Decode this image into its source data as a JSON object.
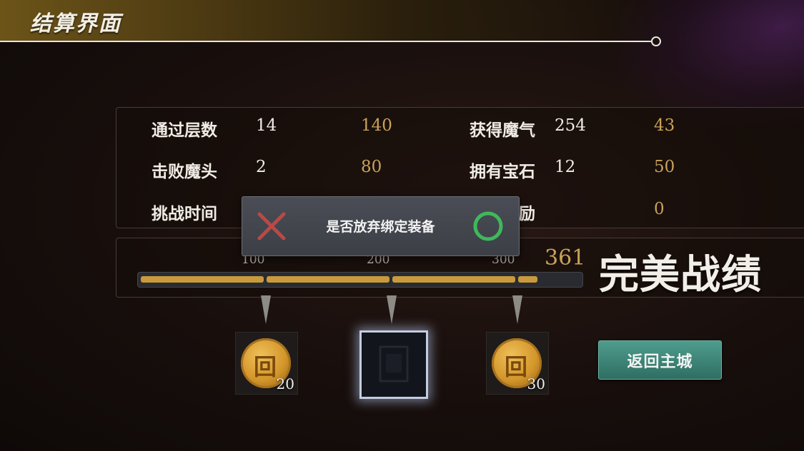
{
  "header": {
    "title": "结算界面"
  },
  "stats": {
    "rows": [
      {
        "label": "通过层数",
        "value": "14",
        "score": "140"
      },
      {
        "label": "击败魔头",
        "value": "2",
        "score": "80"
      },
      {
        "label": "挑战时间",
        "value": "",
        "score": ""
      }
    ],
    "rows_right": [
      {
        "label": "获得魔气",
        "value": "254",
        "score": "43"
      },
      {
        "label": "拥有宝石",
        "value": "12",
        "score": "50"
      },
      {
        "label": "励",
        "value": "",
        "score": "0"
      }
    ]
  },
  "progress": {
    "milestones": [
      "100",
      "200",
      "300"
    ],
    "total": "361",
    "max": 400,
    "rating": "完美战绩"
  },
  "rewards": [
    {
      "type": "coin",
      "count": "20"
    },
    {
      "type": "chest",
      "count": ""
    },
    {
      "type": "coin",
      "count": "30"
    }
  ],
  "buttons": {
    "return": "返回主城"
  },
  "dialog": {
    "message": "是否放弃绑定装备",
    "cancel_icon": "cross-icon",
    "confirm_icon": "circle-icon"
  },
  "colors": {
    "score_gold": "#c9a25a",
    "progress_fill": "#c99a3c",
    "button_teal": "#3f8676",
    "cancel_red": "#b84a46",
    "confirm_green": "#3fb85c"
  }
}
